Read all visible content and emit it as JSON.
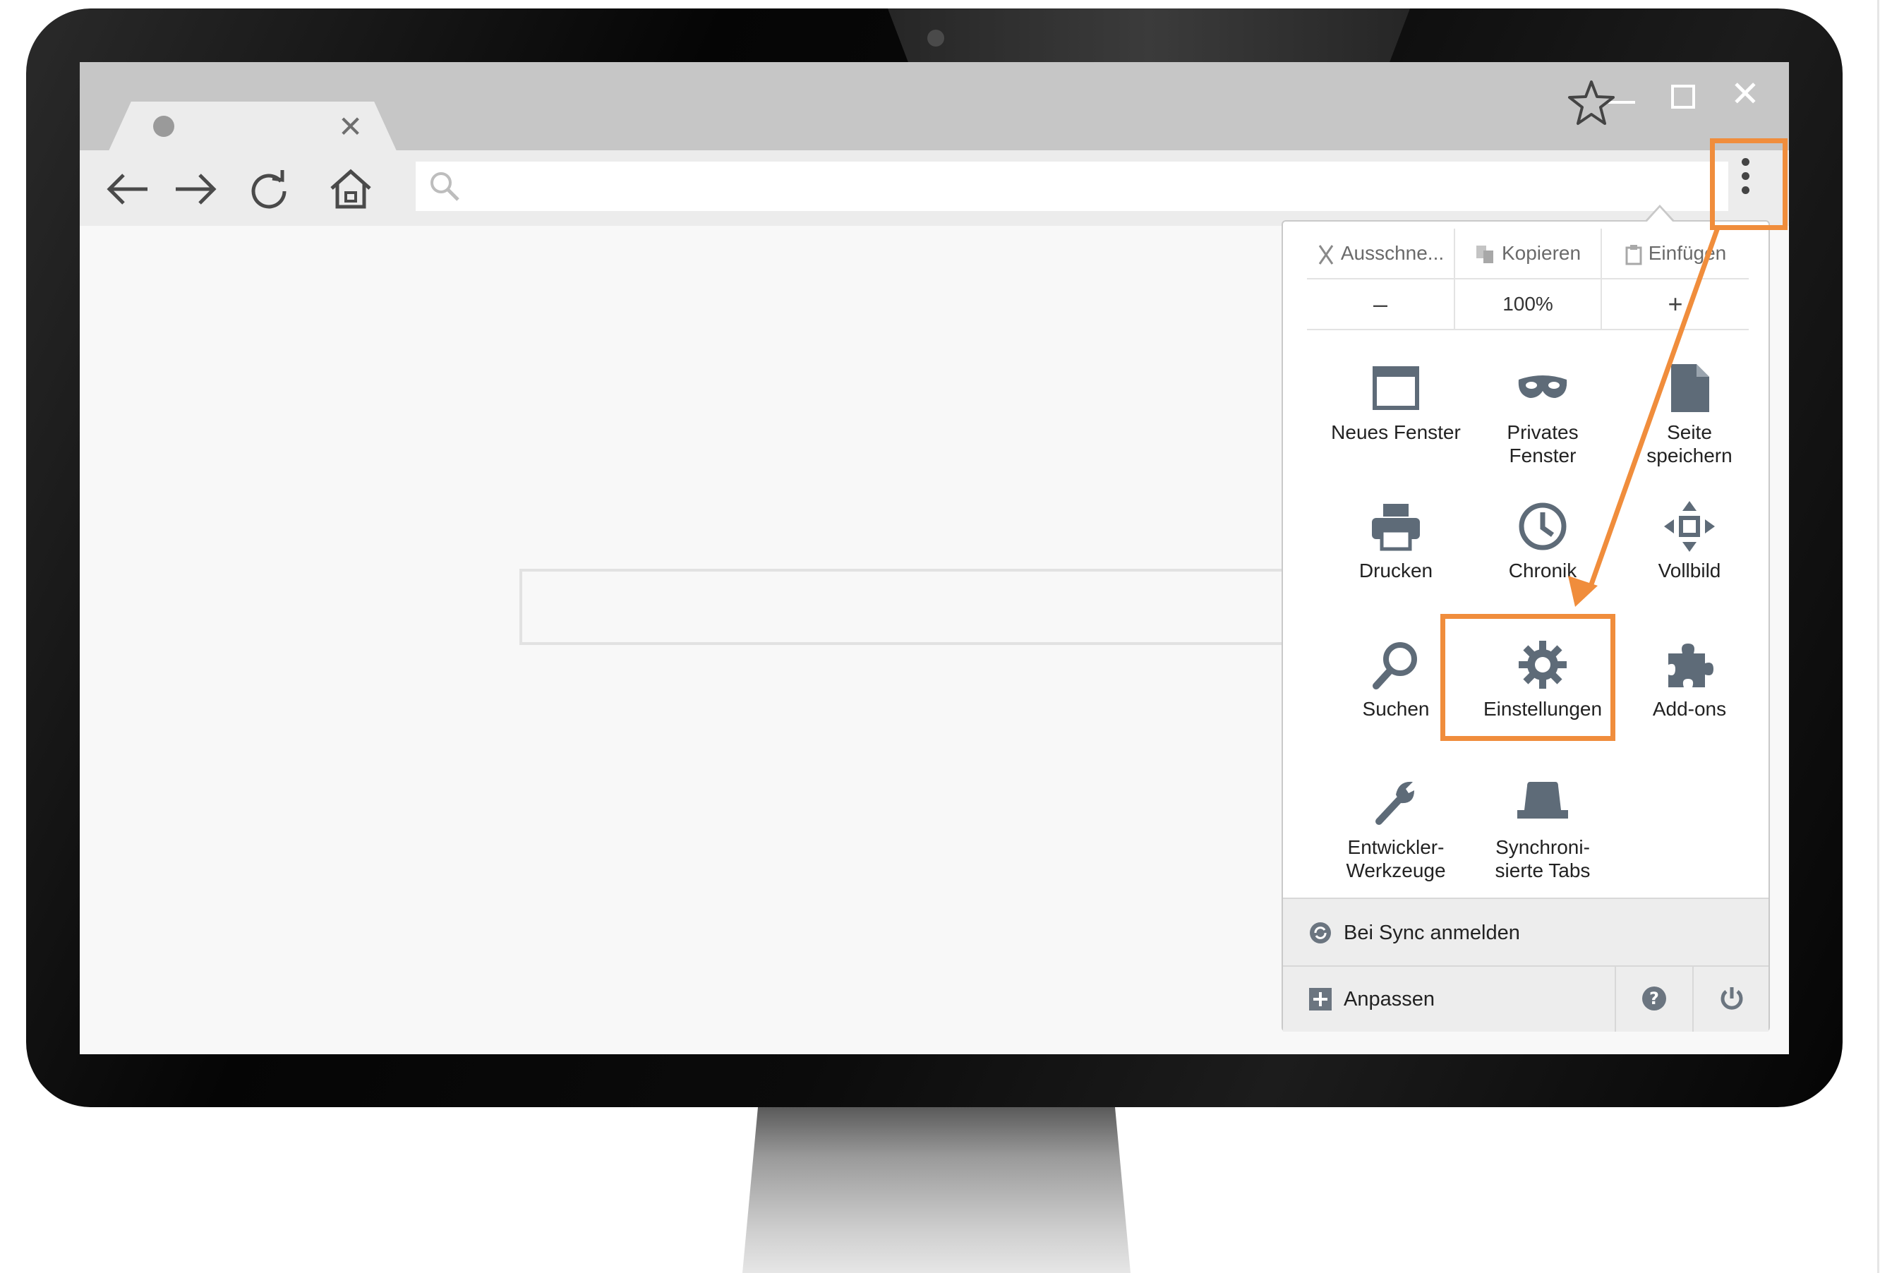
{
  "colors": {
    "accent": "#f08d3c",
    "icon_gray": "#5e6b78"
  },
  "browser": {
    "tab": {
      "close_glyph": "✕",
      "favicon": "circle-icon"
    },
    "window_controls": {
      "close_glyph": "✕"
    },
    "url_bar": {
      "value": "",
      "placeholder": ""
    }
  },
  "menu": {
    "edit_row": {
      "cut": "Ausschne...",
      "copy": "Kopieren",
      "paste": "Einfügen"
    },
    "zoom_row": {
      "minus": "–",
      "level": "100%",
      "plus": "+"
    },
    "items": [
      {
        "line1": "Neues Fenster",
        "line2": "",
        "icon": "window-icon"
      },
      {
        "line1": "Privates",
        "line2": "Fenster",
        "icon": "mask-icon"
      },
      {
        "line1": "Seite",
        "line2": "speichern",
        "icon": "page-icon"
      },
      {
        "line1": "Drucken",
        "line2": "",
        "icon": "printer-icon"
      },
      {
        "line1": "Chronik",
        "line2": "",
        "icon": "clock-icon"
      },
      {
        "line1": "Vollbild",
        "line2": "",
        "icon": "fullscreen-icon"
      },
      {
        "line1": "Suchen",
        "line2": "",
        "icon": "search-icon"
      },
      {
        "line1": "Einstellungen",
        "line2": "",
        "icon": "gear-icon"
      },
      {
        "line1": "Add-ons",
        "line2": "",
        "icon": "puzzle-icon"
      },
      {
        "line1": "Entwickler-",
        "line2": "Werkzeuge",
        "icon": "wrench-icon"
      },
      {
        "line1": "Synchroni-",
        "line2": "sierte Tabs",
        "icon": "synced-tabs-icon"
      }
    ],
    "footer": {
      "sync_label": "Bei Sync anmelden",
      "customize_label": "Anpassen",
      "help_glyph": "?"
    }
  }
}
